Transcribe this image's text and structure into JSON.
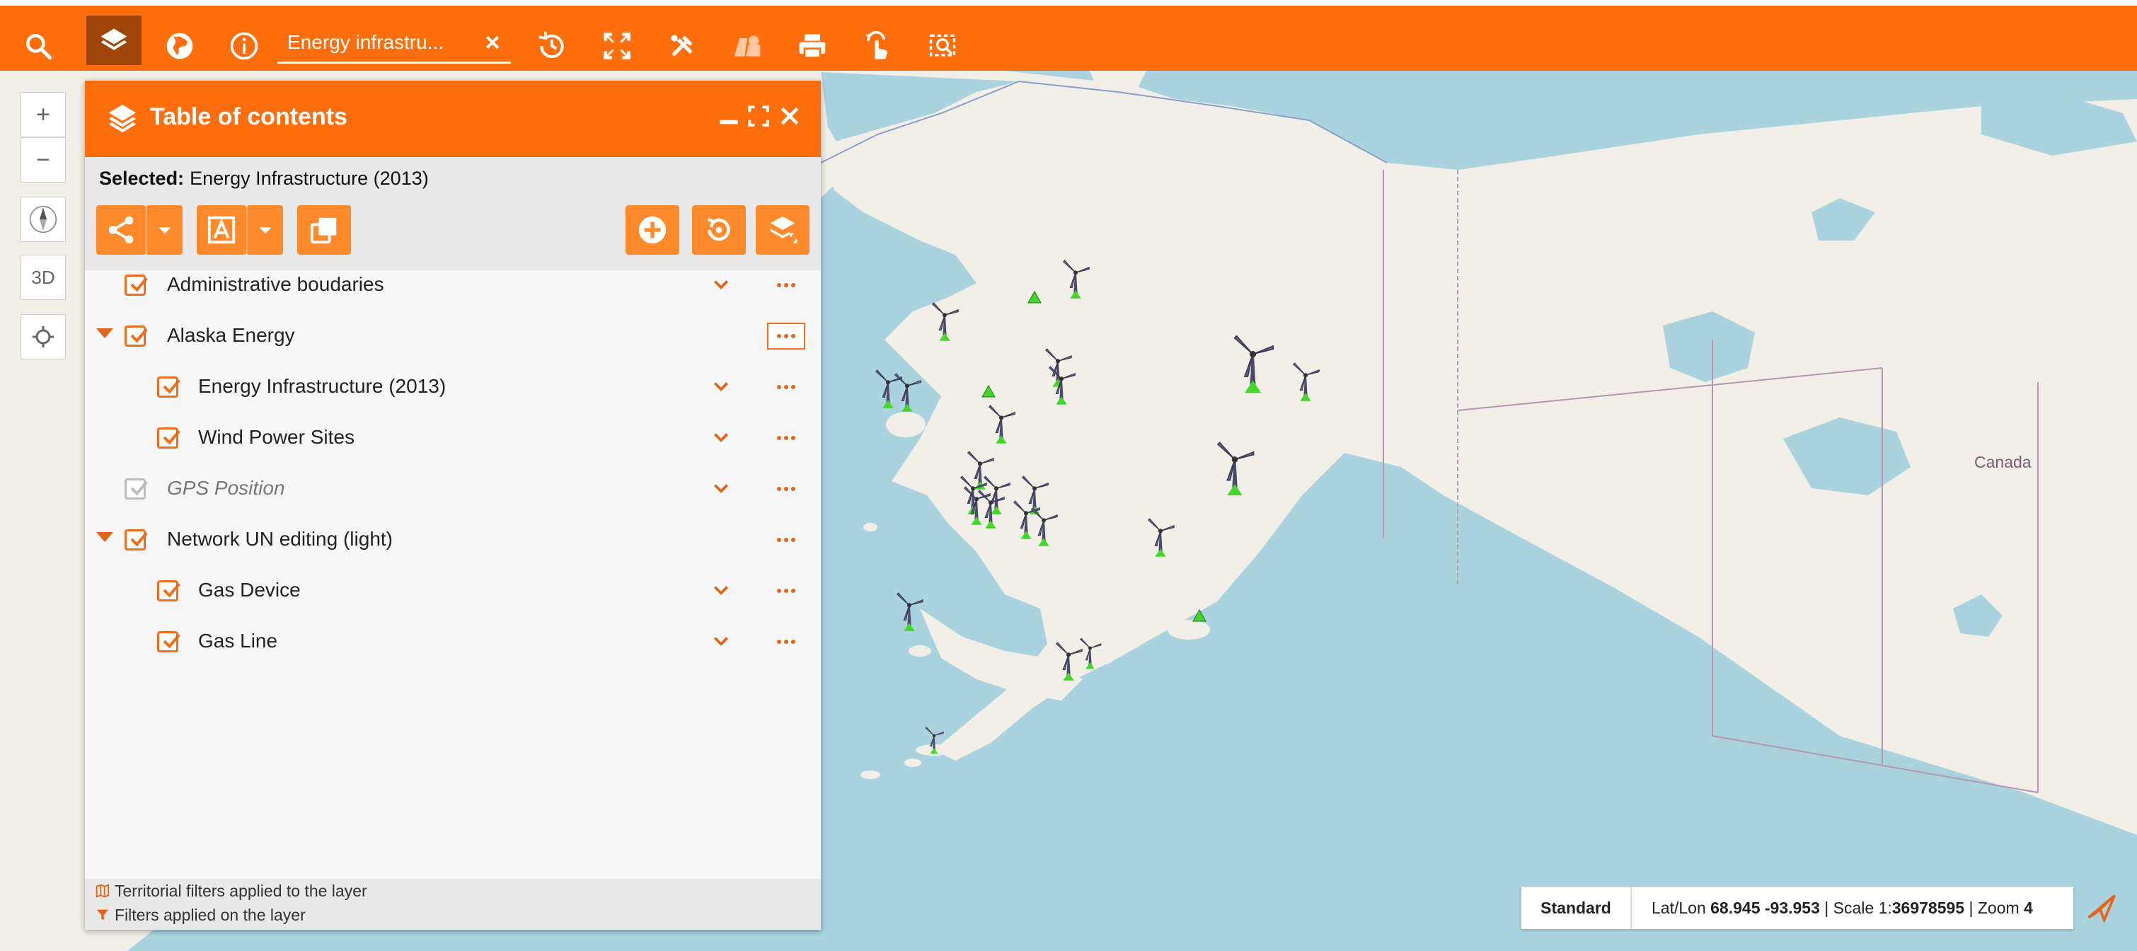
{
  "toolbar": {
    "search_value": "Energy infrastru...",
    "buttons": [
      "search-icon",
      "layers-icon",
      "globe-icon",
      "info-icon",
      "history-icon",
      "fullscreen-icon",
      "tools-icon",
      "map-layers-icon",
      "print-icon",
      "touch-icon",
      "select-area-icon"
    ]
  },
  "map_controls": {
    "zoom_in": "+",
    "zoom_out": "−",
    "three_d": "3D"
  },
  "map": {
    "label_canada": "Canada"
  },
  "toc": {
    "title": "Table of contents",
    "selected_label": "Selected:",
    "selected_value": "Energy Infrastructure (2013)",
    "layers": [
      {
        "label": "Administrative boudaries",
        "checked": true,
        "expanded": null
      },
      {
        "label": "Alaska Energy",
        "checked": true,
        "expanded": true
      },
      {
        "label": "Energy Infrastructure (2013)",
        "checked": true,
        "expanded": null
      },
      {
        "label": "Wind Power Sites",
        "checked": true,
        "expanded": null
      },
      {
        "label": "GPS Position",
        "checked": true,
        "expanded": null,
        "disabled": true
      },
      {
        "label": "Network UN editing (light)",
        "checked": true,
        "expanded": true
      },
      {
        "label": "Gas Device",
        "checked": true,
        "expanded": null
      },
      {
        "label": "Gas Line",
        "checked": true,
        "expanded": null
      }
    ],
    "footer": {
      "territorial": "Territorial filters applied to the layer",
      "filters": "Filters applied on the layer"
    }
  },
  "status": {
    "mode": "Standard",
    "latlon_label": "Lat/Lon",
    "latlon_value": "68.945 -93.953",
    "scale_label": "| Scale 1:",
    "scale_value": "36978595",
    "zoom_label": "| Zoom",
    "zoom_value": "4"
  },
  "colors": {
    "accent": "#fe6e0c",
    "accent_dark": "#9f4508",
    "water": "#aad3df",
    "land": "#f2efe9",
    "marker_green": "#4cd137"
  }
}
